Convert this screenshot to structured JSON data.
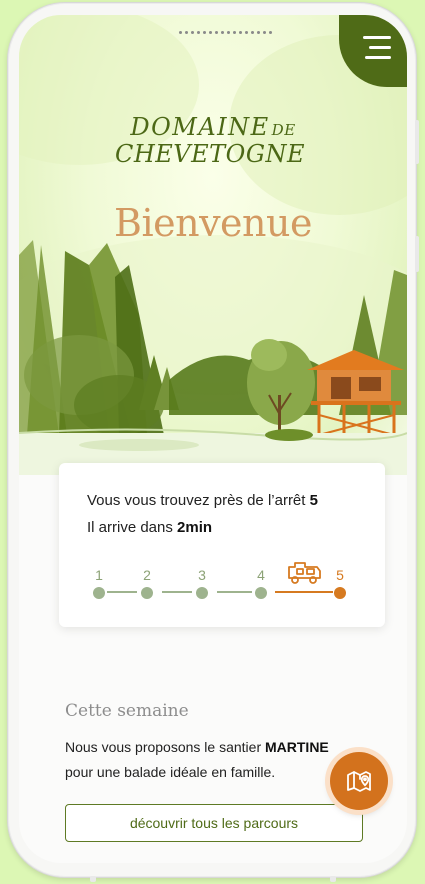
{
  "header": {
    "brand_line1": "DOMAINE",
    "brand_de": "DE",
    "brand_line2": "CHEVETOGNE",
    "welcome": "Bienvenue",
    "menu_icon": "hamburger-menu-icon"
  },
  "stop_card": {
    "line1_prefix": "Vous vous trouvez près de l’arrêt ",
    "line1_stop": "5",
    "line2_prefix": "Il arrive dans ",
    "line2_time": "2min",
    "stops": [
      {
        "label": "1"
      },
      {
        "label": "2"
      },
      {
        "label": "3"
      },
      {
        "label": "4"
      },
      {
        "label": "5"
      }
    ],
    "current_stop": "5",
    "train_icon": "tourist-train-icon"
  },
  "week": {
    "title": "Cette semaine",
    "text_prefix": "Nous vous proposons le santier ",
    "trail_name": "MARTINE",
    "text_suffix": "pour une balade idéale en famille.",
    "button_label": "découvrir tous les parcours"
  },
  "fab": {
    "icon": "map-pin-icon"
  },
  "colors": {
    "brand_green": "#4f6b17",
    "accent_orange": "#d3721d",
    "welcome_text": "#d39a62",
    "muted_stop": "#9eb38e"
  }
}
